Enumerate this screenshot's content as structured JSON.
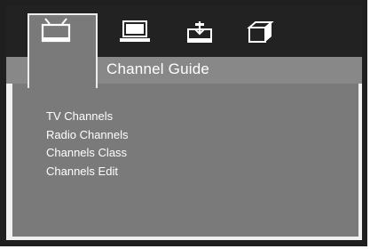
{
  "tabs": [
    {
      "icon": "tv-icon",
      "active": true
    },
    {
      "icon": "laptop-icon",
      "active": false
    },
    {
      "icon": "download-tray-icon",
      "active": false
    },
    {
      "icon": "box-icon",
      "active": false
    }
  ],
  "header": {
    "title": "Channel Guide"
  },
  "menu": {
    "items": [
      "TV Channels",
      "Radio Channels",
      "Channels Class",
      "Channels Edit"
    ]
  },
  "colors": {
    "topbar": "#222222",
    "panel": "#7a7a7a",
    "strip": "#888888",
    "text": "#ffffff"
  }
}
